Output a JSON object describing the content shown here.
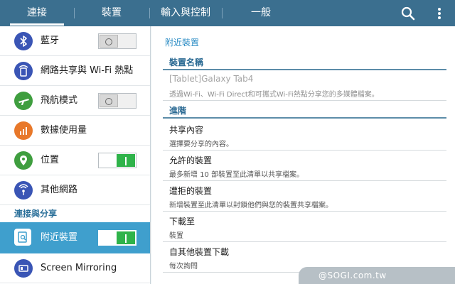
{
  "tabs": [
    {
      "label": "連接",
      "active": true
    },
    {
      "label": "裝置",
      "active": false
    },
    {
      "label": "輸入與控制",
      "active": false
    },
    {
      "label": "一般",
      "active": false
    }
  ],
  "toolbar": {
    "search_icon": "search-icon",
    "more_icon": "overflow-menu-icon"
  },
  "sidebar": {
    "items": [
      {
        "label": "藍牙",
        "icon": "bluetooth-icon",
        "color": "#3a55b5",
        "toggle": "off"
      },
      {
        "label": "網路共享與 Wi-Fi 熱點",
        "icon": "tethering-icon",
        "color": "#3a55b5"
      },
      {
        "label": "飛航模式",
        "icon": "airplane-icon",
        "color": "#3f9e3f",
        "toggle": "off"
      },
      {
        "label": "數據使用量",
        "icon": "data-usage-icon",
        "color": "#e8782a"
      },
      {
        "label": "位置",
        "icon": "location-icon",
        "color": "#3f9e3f",
        "toggle": "on"
      },
      {
        "label": "其他網路",
        "icon": "network-icon",
        "color": "#3a55b5"
      }
    ],
    "section_title": "連接與分享",
    "section_items": [
      {
        "label": "附近裝置",
        "icon": "nearby-devices-icon",
        "color": "#ffffff",
        "toggle": "on",
        "selected": true
      },
      {
        "label": "Screen Mirroring",
        "icon": "screen-mirroring-icon",
        "color": "#3a55b5"
      }
    ]
  },
  "main": {
    "title": "附近裝置",
    "device_name_header": "裝置名稱",
    "device_name": {
      "title": "[Tablet]Galaxy Tab4",
      "sub": "透過Wi-Fi、Wi-Fi Direct和可攜式Wi-Fi熱點分享您的多媒體檔案。"
    },
    "advanced_header": "進階",
    "rows": [
      {
        "title": "共享內容",
        "sub": "選擇要分享的內容。"
      },
      {
        "title": "允許的裝置",
        "sub": "最多新增 10 部裝置至此清單以共享檔案。"
      },
      {
        "title": "遭拒的裝置",
        "sub": "新增裝置至此清單以封鎖他們與您的裝置共享檔案。"
      },
      {
        "title": "下載至",
        "sub": "裝置"
      },
      {
        "title": "自其他裝置下載",
        "sub": "每次詢問"
      }
    ]
  },
  "watermark": "@SOGI.com.tw",
  "colors": {
    "topbar": "#3b6f8f",
    "selected": "#3f9fcd",
    "accent": "#2b8cc4",
    "toggle_on": "#2fb34a"
  }
}
